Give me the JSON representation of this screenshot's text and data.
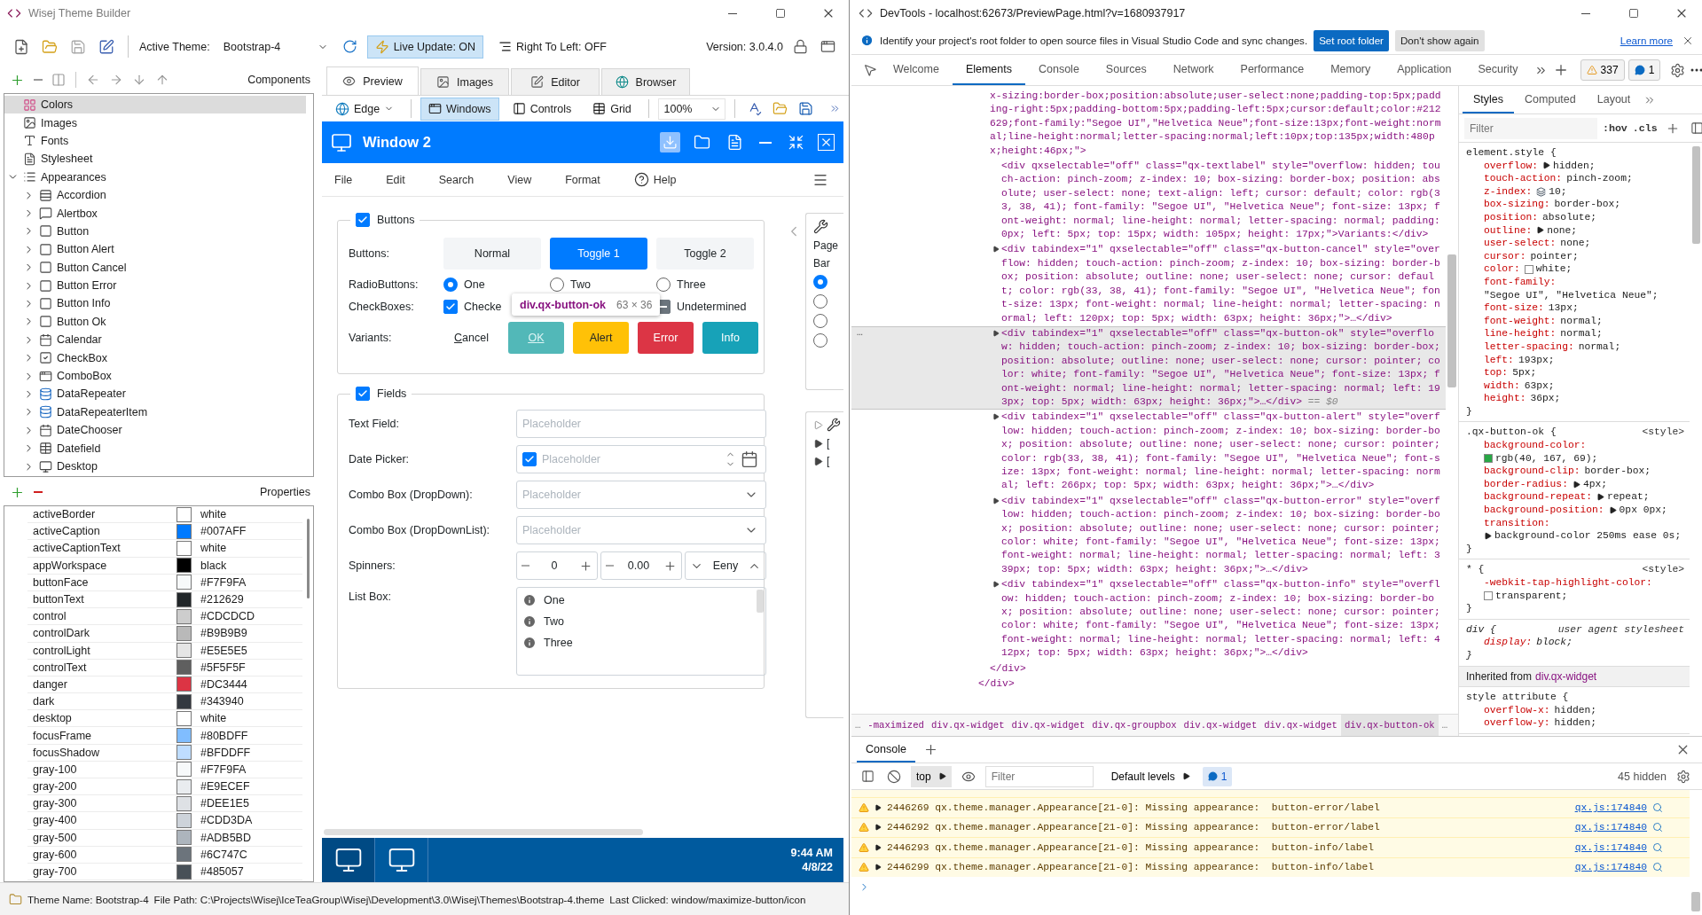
{
  "app": {
    "title": "Wisej Theme Builder",
    "toolbar": {
      "active_theme_label": "Active Theme:",
      "active_theme": "Bootstrap-4",
      "live_update": {
        "label": "Live Update: ON",
        "on": true
      },
      "right_to_left": "Right To Left: OFF",
      "version": "Version: 3.0.4.0"
    },
    "components": {
      "title": "Components",
      "tree": [
        {
          "label": "Colors",
          "selected": true
        },
        {
          "label": "Images",
          "selected": false
        },
        {
          "label": "Fonts",
          "selected": false
        },
        {
          "label": "Stylesheet",
          "selected": false
        },
        {
          "label": "Appearances",
          "selected": false,
          "expanded": true,
          "children": [
            {
              "label": "Accordion",
              "selected": false,
              "expanded": false
            },
            {
              "label": "Alertbox",
              "selected": false,
              "expanded": false
            },
            {
              "label": "Button",
              "selected": false,
              "expanded": false
            },
            {
              "label": "Button Alert",
              "selected": false,
              "expanded": false
            },
            {
              "label": "Button Cancel",
              "selected": false,
              "expanded": false
            },
            {
              "label": "Button Error",
              "selected": false,
              "expanded": false
            },
            {
              "label": "Button Info",
              "selected": false,
              "expanded": false
            },
            {
              "label": "Button Ok",
              "selected": false,
              "expanded": false
            },
            {
              "label": "Calendar",
              "selected": false,
              "expanded": false
            },
            {
              "label": "CheckBox",
              "selected": false,
              "expanded": false
            },
            {
              "label": "ComboBox",
              "selected": false,
              "expanded": false
            },
            {
              "label": "DataRepeater",
              "selected": false,
              "expanded": false
            },
            {
              "label": "DataRepeaterItem",
              "selected": false,
              "expanded": false
            },
            {
              "label": "DateChooser",
              "selected": false,
              "expanded": false
            },
            {
              "label": "Datefield",
              "selected": false,
              "expanded": false
            },
            {
              "label": "Desktop",
              "selected": false,
              "expanded": false
            }
          ]
        }
      ]
    },
    "properties": {
      "title": "Properties",
      "rows": [
        {
          "name": "activeBorder",
          "color": "#ffffff",
          "value": "white"
        },
        {
          "name": "activeCaption",
          "color": "#007aff",
          "value": "#007AFF"
        },
        {
          "name": "activeCaptionText",
          "color": "#ffffff",
          "value": "white"
        },
        {
          "name": "appWorkspace",
          "color": "#000000",
          "value": "black"
        },
        {
          "name": "buttonFace",
          "color": "#f7f9fa",
          "value": "#F7F9FA"
        },
        {
          "name": "buttonText",
          "color": "#212629",
          "value": "#212629"
        },
        {
          "name": "control",
          "color": "#cdcdcd",
          "value": "#CDCDCD"
        },
        {
          "name": "controlDark",
          "color": "#b9b9b9",
          "value": "#B9B9B9"
        },
        {
          "name": "controlLight",
          "color": "#e5e5e5",
          "value": "#E5E5E5"
        },
        {
          "name": "controlText",
          "color": "#5f5f5f",
          "value": "#5F5F5F"
        },
        {
          "name": "danger",
          "color": "#dc3444",
          "value": "#DC3444"
        },
        {
          "name": "dark",
          "color": "#343940",
          "value": "#343940"
        },
        {
          "name": "desktop",
          "color": "#ffffff",
          "value": "white"
        },
        {
          "name": "focusFrame",
          "color": "#80bdff",
          "value": "#80BDFF"
        },
        {
          "name": "focusShadow",
          "color": "#bfddff",
          "value": "#BFDDFF"
        },
        {
          "name": "gray-100",
          "color": "#f7f9fa",
          "value": "#F7F9FA"
        },
        {
          "name": "gray-200",
          "color": "#e9ecef",
          "value": "#E9ECEF"
        },
        {
          "name": "gray-300",
          "color": "#dee1e5",
          "value": "#DEE1E5"
        },
        {
          "name": "gray-400",
          "color": "#cdd3da",
          "value": "#CDD3DA"
        },
        {
          "name": "gray-500",
          "color": "#adb5bd",
          "value": "#ADB5BD"
        },
        {
          "name": "gray-600",
          "color": "#6c747c",
          "value": "#6C747C"
        },
        {
          "name": "gray-700",
          "color": "#485057",
          "value": "#485057"
        }
      ]
    },
    "status_bar": [
      "Theme Name: Bootstrap-4",
      "File Path: C:\\Projects\\Wisej\\IceTeaGroup\\Wisej\\Development\\3.0\\Wisej\\Themes\\Bootstrap-4.theme",
      "Last Clicked: window/maximize-button/icon"
    ]
  },
  "preview": {
    "tabs": [
      {
        "label": "Preview",
        "selected": true
      },
      {
        "label": "Images",
        "selected": false
      },
      {
        "label": "Editor",
        "selected": false
      },
      {
        "label": "Browser",
        "selected": false
      }
    ],
    "toolbar": {
      "browser": "Edge",
      "modes": [
        {
          "label": "Windows",
          "selected": true
        },
        {
          "label": "Controls",
          "selected": false
        },
        {
          "label": "Grid",
          "selected": false
        }
      ],
      "zoom": "100%"
    },
    "window": {
      "title": "Window 2",
      "menu": [
        "File",
        "Edit",
        "Search",
        "View",
        "Format",
        "Help"
      ],
      "buttons_group": {
        "legend": "Buttons",
        "checked": true,
        "buttons_label": "Buttons:",
        "buttons": [
          {
            "label": "Normal",
            "selected": false
          },
          {
            "label": "Toggle 1",
            "selected": true
          },
          {
            "label": "Toggle 2",
            "selected": false
          }
        ],
        "radio_label": "RadioButtons:",
        "radios": [
          {
            "label": "One",
            "selected": true
          },
          {
            "label": "Two",
            "selected": false
          },
          {
            "label": "Three",
            "selected": false
          }
        ],
        "checkbox_label": "CheckBoxes:",
        "checkboxes": [
          {
            "label": "Checke",
            "kind": "two-state",
            "checked": true
          },
          {
            "label": "Undetermined",
            "kind": "three-state",
            "indeterminate": true
          }
        ],
        "variants_label": "Variants:",
        "variants": [
          {
            "label": "Cancel",
            "kind": "cancel"
          },
          {
            "label": "OK",
            "kind": "ok"
          },
          {
            "label": "Alert",
            "kind": "alert"
          },
          {
            "label": "Error",
            "kind": "error"
          },
          {
            "label": "Info",
            "kind": "info"
          }
        ],
        "tooltip": {
          "selector": "div.qx-button-ok",
          "size": "63 × 36"
        }
      },
      "fields_group": {
        "legend": "Fields",
        "checked": true,
        "rows": [
          {
            "label": "Text Field:",
            "kind": "text",
            "placeholder": "Placeholder"
          },
          {
            "label": "Date Picker:",
            "kind": "date",
            "checked": true,
            "placeholder": "Placeholder"
          },
          {
            "label": "Combo Box (DropDown):",
            "kind": "combo",
            "placeholder": "Placeholder"
          },
          {
            "label": "Combo Box (DropDownList):",
            "kind": "combo",
            "placeholder": "Placeholder"
          },
          {
            "label": "Spinners:",
            "kind": "spinners",
            "values": [
              "0",
              "0.00",
              "Eeny"
            ]
          },
          {
            "label": "List Box:",
            "kind": "list",
            "items": [
              "One",
              "Two",
              "Three"
            ]
          }
        ]
      },
      "side_panel": {
        "texts": [
          "Page",
          "Bar"
        ],
        "radios": [
          {
            "selected": true
          },
          {
            "selected": false
          },
          {
            "selected": false
          },
          {
            "selected": false
          }
        ],
        "marks": [
          "[",
          "["
        ]
      }
    },
    "taskbar": {
      "time": "9:44 AM",
      "date": "4/8/22"
    }
  },
  "devtools": {
    "title": "DevTools - localhost:62673/PreviewPage.html?v=1680937917",
    "infobar": {
      "message": "Identify your project's root folder to open source files in Visual Studio Code and sync changes.",
      "primary": "Set root folder",
      "secondary": "Don't show again",
      "link": "Learn more"
    },
    "tabs": [
      {
        "label": "Welcome",
        "selected": false
      },
      {
        "label": "Elements",
        "selected": true
      },
      {
        "label": "Console",
        "selected": false
      },
      {
        "label": "Sources",
        "selected": false
      },
      {
        "label": "Network",
        "selected": false
      },
      {
        "label": "Performance",
        "selected": false
      },
      {
        "label": "Memory",
        "selected": false
      },
      {
        "label": "Application",
        "selected": false
      },
      {
        "label": "Security",
        "selected": false
      }
    ],
    "warnings": "337",
    "messages": "1",
    "elements": {
      "selected_gutter": "…",
      "selected_marker": "== $0",
      "nodes": [
        {
          "kind": "tail",
          "selected": false,
          "text": "x-sizing:border-box;position:absolute;user-select:none;padding-top:5px;padding-right:5px;padding-bottom:5px;padding-left:5px;cursor:default;color:#212629;font-family:\"Segoe UI\",\"Helvetica Neue\";font-size:13px;font-weight:normal;line-height:normal;letter-spacing:normal;left:10px;top:135px;width:480px;height:46px;\">"
        },
        {
          "kind": "leaf",
          "selected": false,
          "text": "<div qxselectable=\"off\" class=\"qx-textlabel\" style=\"overflow: hidden; touch-action: pinch-zoom; z-index: 10; box-sizing: border-box; position: absolute; user-select: none; text-align: left; cursor: default; color: rgb(33, 38, 41); font-family: \"Segoe UI\", \"Helvetica Neue\"; font-size: 13px; font-weight: normal; line-height: normal; letter-spacing: normal; padding: 0px; left: 5px; top: 15px; width: 105px; height: 17px;\">Variants:</div>"
        },
        {
          "kind": "node",
          "selected": false,
          "text": "<div tabindex=\"1\" qxselectable=\"off\" class=\"qx-button-cancel\" style=\"overflow: hidden; touch-action: pinch-zoom; z-index: 10; box-sizing: border-box; position: absolute; outline: none; user-select: none; cursor: default; color: rgb(33, 38, 41); font-family: \"Segoe UI\", \"Helvetica Neue\"; font-size: 13px; font-weight: normal; line-height: normal; letter-spacing: normal; left: 120px; top: 5px; width: 63px; height: 36px;\">…</div>"
        },
        {
          "kind": "node",
          "selected": true,
          "text": "<div tabindex=\"1\" qxselectable=\"off\" class=\"qx-button-ok\" style=\"overflow: hidden; touch-action: pinch-zoom; z-index: 10; box-sizing: border-box; position: absolute; outline: none; user-select: none; cursor: pointer; color: white; font-family: \"Segoe UI\", \"Helvetica Neue\"; font-size: 13px; font-weight: normal; line-height: normal; letter-spacing: normal; left: 193px; top: 5px; width: 63px; height: 36px;\">…</div>"
        },
        {
          "kind": "node",
          "selected": false,
          "text": "<div tabindex=\"1\" qxselectable=\"off\" class=\"qx-button-alert\" style=\"overflow: hidden; touch-action: pinch-zoom; z-index: 10; box-sizing: border-box; position: absolute; outline: none; user-select: none; cursor: pointer; color: rgb(33, 38, 41); font-family: \"Segoe UI\", \"Helvetica Neue\"; font-size: 13px; font-weight: normal; line-height: normal; letter-spacing: normal; left: 266px; top: 5px; width: 63px; height: 36px;\">…</div>"
        },
        {
          "kind": "node",
          "selected": false,
          "text": "<div tabindex=\"1\" qxselectable=\"off\" class=\"qx-button-error\" style=\"overflow: hidden; touch-action: pinch-zoom; z-index: 10; box-sizing: border-box; position: absolute; outline: none; user-select: none; cursor: pointer; color: white; font-family: \"Segoe UI\", \"Helvetica Neue\"; font-size: 13px; font-weight: normal; line-height: normal; letter-spacing: normal; left: 339px; top: 5px; width: 63px; height: 36px;\">…</div>"
        },
        {
          "kind": "node",
          "selected": false,
          "text": "<div tabindex=\"1\" qxselectable=\"off\" class=\"qx-button-info\" style=\"overflow: hidden; touch-action: pinch-zoom; z-index: 10; box-sizing: border-box; position: absolute; outline: none; user-select: none; cursor: pointer; color: white; font-family: \"Segoe UI\", \"Helvetica Neue\"; font-size: 13px; font-weight: normal; line-height: normal; letter-spacing: normal; left: 412px; top: 5px; width: 63px; height: 36px;\">…</div>"
        },
        {
          "kind": "close",
          "selected": false,
          "text": "</div>"
        },
        {
          "kind": "close-outer",
          "selected": false,
          "text": "</div>"
        }
      ],
      "breadcrumb": {
        "more_left": "…",
        "more_right": "…",
        "items": [
          {
            "label": "-maximized",
            "selected": false
          },
          {
            "label": "div.qx-widget",
            "selected": false
          },
          {
            "label": "div.qx-widget",
            "selected": false
          },
          {
            "label": "div.qx-groupbox",
            "selected": false
          },
          {
            "label": "div.qx-widget",
            "selected": false
          },
          {
            "label": "div.qx-widget",
            "selected": false
          },
          {
            "label": "div.qx-button-ok",
            "selected": true
          }
        ]
      }
    },
    "styles": {
      "tabs": [
        {
          "label": "Styles",
          "selected": true
        },
        {
          "label": "Computed",
          "selected": false
        },
        {
          "label": "Layout",
          "selected": false
        }
      ],
      "filter_placeholder": "Filter",
      "hov": ":hov",
      "cls": ".cls",
      "rules": [
        {
          "kind": "rule",
          "selector": "element.style {",
          "close": "}",
          "declarations": [
            {
              "name": "overflow:",
              "value": "hidden;",
              "kind": "expand"
            },
            {
              "name": "touch-action:",
              "value": "pinch-zoom;",
              "kind": "plain"
            },
            {
              "name": "z-index:",
              "value": "10;",
              "kind": "layers"
            },
            {
              "name": "box-sizing:",
              "value": "border-box;",
              "kind": "plain"
            },
            {
              "name": "position:",
              "value": "absolute;",
              "kind": "plain"
            },
            {
              "name": "outline:",
              "value": "none;",
              "kind": "expand"
            },
            {
              "name": "user-select:",
              "value": "none;",
              "kind": "plain"
            },
            {
              "name": "cursor:",
              "value": "pointer;",
              "kind": "plain"
            },
            {
              "name": "color:",
              "value": "white;",
              "kind": "swatch",
              "color": "#ffffff"
            },
            {
              "name": "font-family:",
              "value": "\"Segoe UI\", \"Helvetica Neue\";",
              "kind": "plain"
            },
            {
              "name": "font-size:",
              "value": "13px;",
              "kind": "plain"
            },
            {
              "name": "font-weight:",
              "value": "normal;",
              "kind": "plain"
            },
            {
              "name": "line-height:",
              "value": "normal;",
              "kind": "plain"
            },
            {
              "name": "letter-spacing:",
              "value": "normal;",
              "kind": "plain"
            },
            {
              "name": "left:",
              "value": "193px;",
              "kind": "plain"
            },
            {
              "name": "top:",
              "value": "5px;",
              "kind": "plain"
            },
            {
              "name": "width:",
              "value": "63px;",
              "kind": "plain"
            },
            {
              "name": "height:",
              "value": "36px;",
              "kind": "plain"
            }
          ]
        },
        {
          "kind": "rule",
          "selector": ".qx-button-ok {",
          "source": "<style>",
          "close": "}",
          "declarations": [
            {
              "name": "background-color:",
              "value": "rgb(40, 167, 69);",
              "kind": "swatch",
              "color": "#28a745"
            },
            {
              "name": "background-clip:",
              "value": "border-box;",
              "kind": "plain"
            },
            {
              "name": "border-radius:",
              "value": "4px;",
              "kind": "expand"
            },
            {
              "name": "background-repeat:",
              "value": "repeat;",
              "kind": "expand"
            },
            {
              "name": "background-position:",
              "value": "0px 0px;",
              "kind": "expand"
            },
            {
              "name": "transition:",
              "value": "background-color 250ms ease 0s;",
              "kind": "expand"
            }
          ]
        },
        {
          "kind": "rule",
          "selector": "* {",
          "source": "<style>",
          "close": "}",
          "declarations": [
            {
              "name": "-webkit-tap-highlight-color:",
              "value": "transparent;",
              "kind": "swatch",
              "color": "#ffffff"
            }
          ]
        },
        {
          "kind": "ua",
          "selector": "div {",
          "source": "user agent stylesheet",
          "close": "}",
          "declarations": [
            {
              "name": "display:",
              "value": "block;",
              "kind": "plain"
            }
          ]
        },
        {
          "kind": "inherited",
          "label": "Inherited from",
          "selector": "div.qx-widget"
        },
        {
          "kind": "rule",
          "selector": "style attribute {",
          "declarations": [
            {
              "name": "overflow-x:",
              "value": "hidden;",
              "kind": "plain"
            },
            {
              "name": "overflow-y:",
              "value": "hidden;",
              "kind": "plain"
            }
          ]
        }
      ]
    },
    "console": {
      "tab": "Console",
      "context": "top",
      "filter_placeholder": "Filter",
      "levels": "Default levels",
      "badge": "1",
      "hidden": "45 hidden",
      "messages": [
        {
          "text": "2446269 qx.theme.manager.Appearance[21-0]: Missing appearance:  button-error/label",
          "source": "qx.js:174840"
        },
        {
          "text": "2446292 qx.theme.manager.Appearance[21-0]: Missing appearance:  button-error/label",
          "source": "qx.js:174840"
        },
        {
          "text": "2446293 qx.theme.manager.Appearance[21-0]: Missing appearance:  button-info/label",
          "source": "qx.js:174840"
        },
        {
          "text": "2446299 qx.theme.manager.Appearance[21-0]: Missing appearance:  button-info/label",
          "source": "qx.js:174840"
        }
      ]
    }
  }
}
